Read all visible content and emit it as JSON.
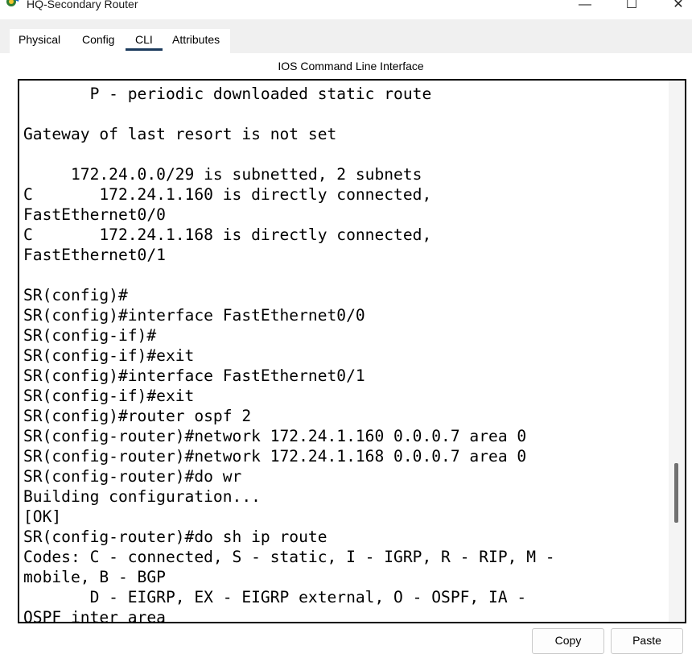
{
  "window": {
    "title": "HQ-Secondary Router",
    "minimize_glyph": "—",
    "maximize_glyph": "☐",
    "close_glyph": "✕"
  },
  "tabs": [
    {
      "label": "Physical",
      "active": false
    },
    {
      "label": "Config",
      "active": false
    },
    {
      "label": "CLI",
      "active": true
    },
    {
      "label": "Attributes",
      "active": false
    }
  ],
  "cli": {
    "heading": "IOS Command Line Interface",
    "lines": [
      "       P - periodic downloaded static route",
      "",
      "Gateway of last resort is not set",
      "",
      "     172.24.0.0/29 is subnetted, 2 subnets",
      "C       172.24.1.160 is directly connected,",
      "FastEthernet0/0",
      "C       172.24.1.168 is directly connected,",
      "FastEthernet0/1",
      "",
      "SR(config)#",
      "SR(config)#interface FastEthernet0/0",
      "SR(config-if)#",
      "SR(config-if)#exit",
      "SR(config)#interface FastEthernet0/1",
      "SR(config-if)#exit",
      "SR(config)#router ospf 2",
      "SR(config-router)#network 172.24.1.160 0.0.0.7 area 0",
      "SR(config-router)#network 172.24.1.168 0.0.0.7 area 0",
      "SR(config-router)#do wr",
      "Building configuration...",
      "[OK]",
      "SR(config-router)#do sh ip route",
      "Codes: C - connected, S - static, I - IGRP, R - RIP, M -",
      "mobile, B - BGP",
      "       D - EIGRP, EX - EIGRP external, O - OSPF, IA -",
      "OSPF inter area"
    ]
  },
  "buttons": {
    "copy": "Copy",
    "paste": "Paste"
  },
  "colors": {
    "active_tab_underline": "#1b3a5c",
    "terminal_border": "#000000"
  },
  "icons": {
    "app": "packet-tracer-router-icon"
  }
}
